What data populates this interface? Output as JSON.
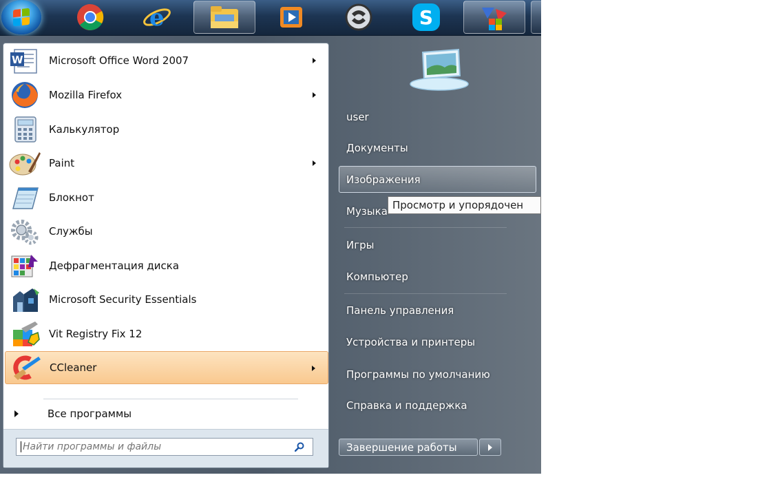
{
  "taskbar": {
    "start_button": "start-orb",
    "apps": [
      {
        "name": "chrome",
        "icon": "chrome-icon"
      },
      {
        "name": "internet-explorer",
        "icon": "ie-icon"
      },
      {
        "name": "explorer",
        "icon": "folder-icon"
      },
      {
        "name": "media-player",
        "icon": "play-icon"
      },
      {
        "name": "app",
        "icon": "app-icon"
      },
      {
        "name": "skype",
        "icon": "skype-icon",
        "label": "S"
      },
      {
        "name": "app2",
        "icon": "app2-icon"
      }
    ]
  },
  "start_menu": {
    "programs": [
      {
        "label": "Microsoft Office Word 2007",
        "icon": "word-icon",
        "submenu": true
      },
      {
        "label": "Mozilla Firefox",
        "icon": "firefox-icon",
        "submenu": true
      },
      {
        "label": "Калькулятор",
        "icon": "calculator-icon",
        "submenu": false
      },
      {
        "label": "Paint",
        "icon": "paint-icon",
        "submenu": true
      },
      {
        "label": "Блокнот",
        "icon": "notepad-icon",
        "submenu": false
      },
      {
        "label": "Службы",
        "icon": "services-icon",
        "submenu": false
      },
      {
        "label": "Дефрагментация диска",
        "icon": "defrag-icon",
        "submenu": false
      },
      {
        "label": "Microsoft Security Essentials",
        "icon": "security-icon",
        "submenu": false
      },
      {
        "label": "Vit Registry Fix 12",
        "icon": "registry-icon",
        "submenu": false
      },
      {
        "label": "CCleaner",
        "icon": "ccleaner-icon",
        "submenu": true,
        "highlighted": true
      }
    ],
    "all_programs": "Все программы",
    "search": {
      "placeholder": "Найти программы и файлы",
      "value": ""
    },
    "right": {
      "user": "user",
      "documents": "Документы",
      "pictures": "Изображения",
      "music": "Музыка",
      "games": "Игры",
      "computer": "Компьютер",
      "control_panel": "Панель управления",
      "devices": "Устройства и принтеры",
      "default_programs": "Программы по умолчанию",
      "help": "Справка и поддержка"
    },
    "tooltip": "Просмотр и упорядочен",
    "shutdown": "Завершение работы"
  },
  "colors": {
    "highlight": "#f9c98f",
    "taskbar": "#1d3553",
    "menu_frame": "#5a6776"
  }
}
